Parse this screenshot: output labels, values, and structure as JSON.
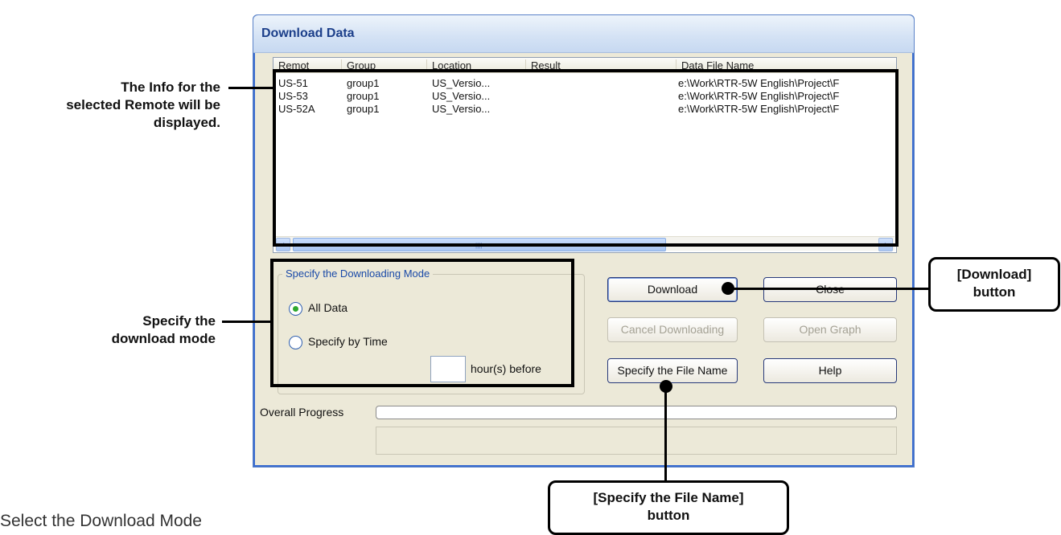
{
  "dialog": {
    "title": "Download Data",
    "list": {
      "columns": [
        "Remot",
        "Group",
        "Location",
        "Result",
        "Data File Name"
      ],
      "rows": [
        {
          "remote": "US-51",
          "group": "group1",
          "location": "US_Versio...",
          "result": "",
          "file": "e:\\Work\\RTR-5W English\\Project\\F"
        },
        {
          "remote": "US-53",
          "group": "group1",
          "location": "US_Versio...",
          "result": "",
          "file": "e:\\Work\\RTR-5W English\\Project\\F"
        },
        {
          "remote": "US-52A",
          "group": "group1",
          "location": "US_Versio...",
          "result": "",
          "file": "e:\\Work\\RTR-5W English\\Project\\F"
        }
      ],
      "scroll_left": "‹",
      "scroll_right": "›",
      "scroll_grip": "||||"
    },
    "mode": {
      "group_title": "Specify the Downloading Mode",
      "all_data": "All Data",
      "by_time": "Specify by Time",
      "selected": "All Data",
      "hours_value": "",
      "hours_suffix": "hour(s) before"
    },
    "buttons": {
      "download": "Download",
      "close": "Close",
      "cancel": "Cancel Downloading",
      "open_graph": "Open Graph",
      "specify_file": "Specify the File Name",
      "help": "Help"
    },
    "progress": {
      "label": "Overall Progress",
      "value": 0,
      "status": ""
    }
  },
  "annotations": {
    "info_line1": "The Info for the",
    "info_line2": "selected Remote will be",
    "info_line3": "displayed.",
    "mode_line1": "Specify the",
    "mode_line2": "download mode",
    "download_line1": "[Download]",
    "download_line2": "button",
    "specify_line1": "[Specify the File Name]",
    "specify_line2": "button"
  },
  "caption": "Select the Download Mode"
}
